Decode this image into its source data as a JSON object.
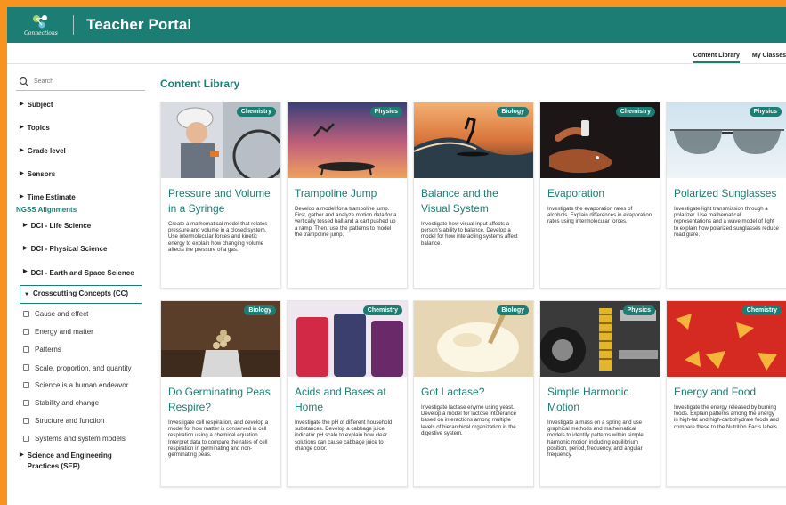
{
  "app": {
    "logo_text": "Connections",
    "portal_title": "Teacher Portal",
    "brand_color": "#1b7d73",
    "accent_color": "#f7931e"
  },
  "subnav": {
    "tabs": [
      {
        "label": "Content Library",
        "active": true
      },
      {
        "label": "My Classes",
        "active": false
      }
    ]
  },
  "sidebar": {
    "search_placeholder": "Search",
    "search_icon": "search-icon",
    "filters": [
      {
        "label": "Subject"
      },
      {
        "label": "Topics"
      },
      {
        "label": "Grade level"
      },
      {
        "label": "Sensors"
      },
      {
        "label": "Time Estimate"
      }
    ],
    "ngss_title": "NGSS Alignments",
    "ngss_filters": [
      {
        "label": "DCI - Life Science"
      },
      {
        "label": "DCI - Physical Science"
      },
      {
        "label": "DCI - Earth and Space Science"
      }
    ],
    "cc_title": "Crosscutting Concepts (CC)",
    "cc_items": [
      {
        "label": "Cause and effect",
        "checked": false
      },
      {
        "label": "Energy and matter",
        "checked": false
      },
      {
        "label": "Patterns",
        "checked": false
      },
      {
        "label": "Scale, proportion, and quantity",
        "checked": false
      },
      {
        "label": "Science is a human endeavor",
        "checked": false
      },
      {
        "label": "Stability and change",
        "checked": false
      },
      {
        "label": "Structure and function",
        "checked": false
      },
      {
        "label": "Systems and system models",
        "checked": false
      }
    ],
    "sep_title": "Science and Engineering Practices (SEP)"
  },
  "main": {
    "title": "Content Library",
    "cards": [
      {
        "subject": "Chemistry",
        "title": "Pressure and Volume in a Syringe",
        "desc": "Create a mathematical model that relates pressure and volume in a closed system. Use intermolecular forces and kinetic energy to explain how changing volume affects the pressure of a gas."
      },
      {
        "subject": "Physics",
        "title": "Trampoline Jump",
        "desc": "Develop a model for a trampoline jump. First, gather and analyze motion data for a vertically tossed ball and a cart pushed up a ramp. Then, use the patterns to model the trampoline jump."
      },
      {
        "subject": "Biology",
        "title": "Balance and the Visual System",
        "desc": "Investigate how visual input affects a person's ability to balance. Develop a model for how interacting systems affect balance."
      },
      {
        "subject": "Chemistry",
        "title": "Evaporation",
        "desc": "Investigate the evaporation rates of alcohols. Explain differences in evaporation rates using intermolecular forces."
      },
      {
        "subject": "Physics",
        "title": "Polarized Sunglasses",
        "desc": "Investigate light transmission through a polarizer. Use mathematical representations and a wave model of light to explain how polarized sunglasses reduce road glare."
      },
      {
        "subject": "Biology",
        "title": "Do Germinating Peas Respire?",
        "desc": "Investigate cell respiration, and develop a model for how matter is conserved in cell respiration using a chemical equation. Interpret data to compare the rates of cell respiration in germinating and non-germinating peas."
      },
      {
        "subject": "Chemistry",
        "title": "Acids and Bases at Home",
        "desc": "Investigate the pH of different household substances. Develop a cabbage juice indicator pH scale to explain how clear solutions can cause cabbage juice to change color."
      },
      {
        "subject": "Biology",
        "title": "Got Lactase?",
        "desc": "Investigate lactase enyme using yeast. Develop a model for lactose intolerance based on interactions among multiple levels of hierarchical organization in the digestive system."
      },
      {
        "subject": "Physics",
        "title": "Simple Harmonic Motion",
        "desc": "Investigate a mass on a spring and use graphical methods and mathematical models to identify patterns within simple harmonic motion including equilibrium position, period, frequency, and angular frequency."
      },
      {
        "subject": "Chemistry",
        "title": "Energy and Food",
        "desc": "Investigate the energy released by burning foods. Explain patterns among the energy in high-fat and high-carbohydrate foods and compare these to the Nutrition Facts labels."
      }
    ]
  }
}
